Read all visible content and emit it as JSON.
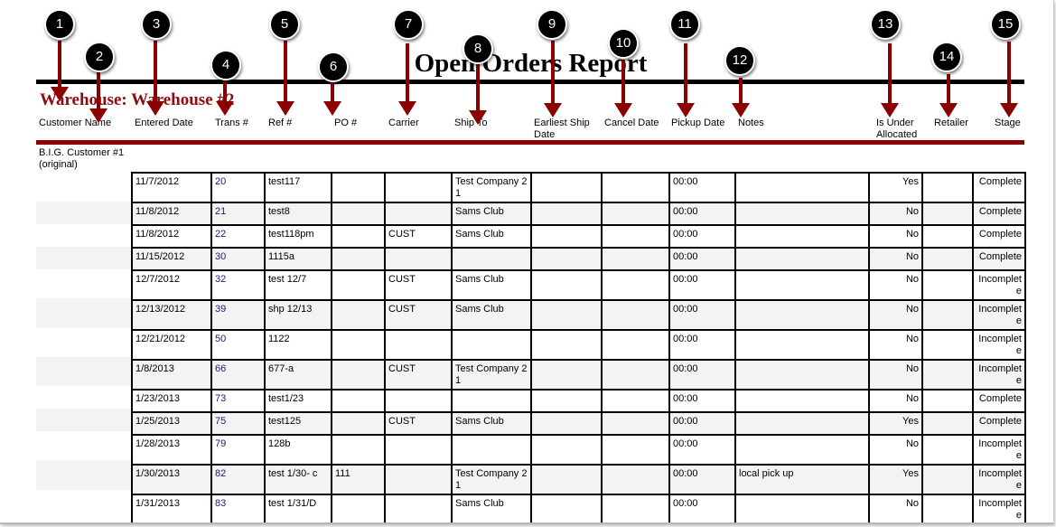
{
  "report": {
    "title": "Open Orders Report",
    "warehouse_label": "Warehouse: Warehouse #2",
    "customer": "B.I.G. Customer #1 (original)"
  },
  "columns": [
    {
      "n": "1",
      "label": "Customer Name"
    },
    {
      "n": "2",
      "label": "Customer Name"
    },
    {
      "n": "3",
      "label": "Entered Date"
    },
    {
      "n": "4",
      "label": "Trans #"
    },
    {
      "n": "5",
      "label": "Ref #"
    },
    {
      "n": "6",
      "label": "PO #"
    },
    {
      "n": "7",
      "label": "Carrier"
    },
    {
      "n": "8",
      "label": "Ship To"
    },
    {
      "n": "9",
      "label": "Earliest Ship Date"
    },
    {
      "n": "10",
      "label": "Cancel Date"
    },
    {
      "n": "11",
      "label": "Pickup Date"
    },
    {
      "n": "12",
      "label": "Notes"
    },
    {
      "n": "13",
      "label": "Is Under Allocated"
    },
    {
      "n": "14",
      "label": "Retailer"
    },
    {
      "n": "15",
      "label": "Stage"
    }
  ],
  "headers": {
    "customer_name": "Customer Name",
    "entered_date": "Entered Date",
    "trans": "Trans #",
    "ref": "Ref #",
    "po": "PO #",
    "carrier": "Carrier",
    "ship_to": "Ship To",
    "earliest_ship_date": "Earliest Ship Date",
    "cancel_date": "Cancel Date",
    "pickup_date": "Pickup Date",
    "notes": "Notes",
    "is_under_allocated": "Is Under Allocated",
    "retailer": "Retailer",
    "stage": "Stage"
  },
  "callouts": [
    "1",
    "2",
    "3",
    "4",
    "5",
    "6",
    "7",
    "8",
    "9",
    "10",
    "11",
    "12",
    "13",
    "14",
    "15"
  ],
  "rows": [
    {
      "entered": "11/7/2012",
      "trans": "20",
      "ref": "test117",
      "po": "",
      "carrier": "",
      "ship_to": "Test Company 21",
      "earliest": "",
      "cancel": "",
      "pickup": "00:00",
      "notes": "",
      "under": "Yes",
      "retailer": "",
      "stage": "Complete"
    },
    {
      "entered": "11/8/2012",
      "trans": "21",
      "ref": "test8",
      "po": "",
      "carrier": "",
      "ship_to": "Sams Club",
      "earliest": "",
      "cancel": "",
      "pickup": "00:00",
      "notes": "",
      "under": "No",
      "retailer": "",
      "stage": "Complete"
    },
    {
      "entered": "11/8/2012",
      "trans": "22",
      "ref": "test118pm",
      "po": "",
      "carrier": "CUST",
      "ship_to": "Sams Club",
      "earliest": "",
      "cancel": "",
      "pickup": "00:00",
      "notes": "",
      "under": "No",
      "retailer": "",
      "stage": "Complete"
    },
    {
      "entered": "11/15/2012",
      "trans": "30",
      "ref": "1115a",
      "po": "",
      "carrier": "",
      "ship_to": "",
      "earliest": "",
      "cancel": "",
      "pickup": "00:00",
      "notes": "",
      "under": "No",
      "retailer": "",
      "stage": "Complete"
    },
    {
      "entered": "12/7/2012",
      "trans": "32",
      "ref": "test 12/7",
      "po": "",
      "carrier": "CUST",
      "ship_to": "Sams Club",
      "earliest": "",
      "cancel": "",
      "pickup": "00:00",
      "notes": "",
      "under": "No",
      "retailer": "",
      "stage": "Incomplete"
    },
    {
      "entered": "12/13/2012",
      "trans": "39",
      "ref": "shp 12/13",
      "po": "",
      "carrier": "CUST",
      "ship_to": "Sams Club",
      "earliest": "",
      "cancel": "",
      "pickup": "00:00",
      "notes": "",
      "under": "No",
      "retailer": "",
      "stage": "Incomplete"
    },
    {
      "entered": "12/21/2012",
      "trans": "50",
      "ref": "1122",
      "po": "",
      "carrier": "",
      "ship_to": "",
      "earliest": "",
      "cancel": "",
      "pickup": "00:00",
      "notes": "",
      "under": "No",
      "retailer": "",
      "stage": "Incomplete"
    },
    {
      "entered": "1/8/2013",
      "trans": "66",
      "ref": "677-a",
      "po": "",
      "carrier": "CUST",
      "ship_to": "Test Company 21",
      "earliest": "",
      "cancel": "",
      "pickup": "00:00",
      "notes": "",
      "under": "No",
      "retailer": "",
      "stage": "Incomplete"
    },
    {
      "entered": "1/23/2013",
      "trans": "73",
      "ref": "test1/23",
      "po": "",
      "carrier": "",
      "ship_to": "",
      "earliest": "",
      "cancel": "",
      "pickup": "00:00",
      "notes": "",
      "under": "No",
      "retailer": "",
      "stage": "Complete"
    },
    {
      "entered": "1/25/2013",
      "trans": "75",
      "ref": "test125",
      "po": "",
      "carrier": "CUST",
      "ship_to": "Sams Club",
      "earliest": "",
      "cancel": "",
      "pickup": "00:00",
      "notes": "",
      "under": "Yes",
      "retailer": "",
      "stage": "Complete"
    },
    {
      "entered": "1/28/2013",
      "trans": "79",
      "ref": "128b",
      "po": "",
      "carrier": "",
      "ship_to": "",
      "earliest": "",
      "cancel": "",
      "pickup": "00:00",
      "notes": "",
      "under": "No",
      "retailer": "",
      "stage": "Incomplete"
    },
    {
      "entered": "1/30/2013",
      "trans": "82",
      "ref": "test 1/30- c",
      "po": "111",
      "carrier": "",
      "ship_to": "Test Company 21",
      "earliest": "",
      "cancel": "",
      "pickup": "00:00",
      "notes": "local pick up",
      "under": "Yes",
      "retailer": "",
      "stage": "Incomplete"
    },
    {
      "entered": "1/31/2013",
      "trans": "83",
      "ref": "test 1/31/D",
      "po": "",
      "carrier": "",
      "ship_to": "Sams Club",
      "earliest": "",
      "cancel": "",
      "pickup": "00:00",
      "notes": "",
      "under": "No",
      "retailer": "",
      "stage": "Incomplete"
    }
  ],
  "colors": {
    "callout_arrow": "#8b0000",
    "warehouse_text": "#8b0e10",
    "red_rule": "#8b0000",
    "trans_link": "#1a1a7a",
    "alt_row": "#f3f3f3"
  }
}
